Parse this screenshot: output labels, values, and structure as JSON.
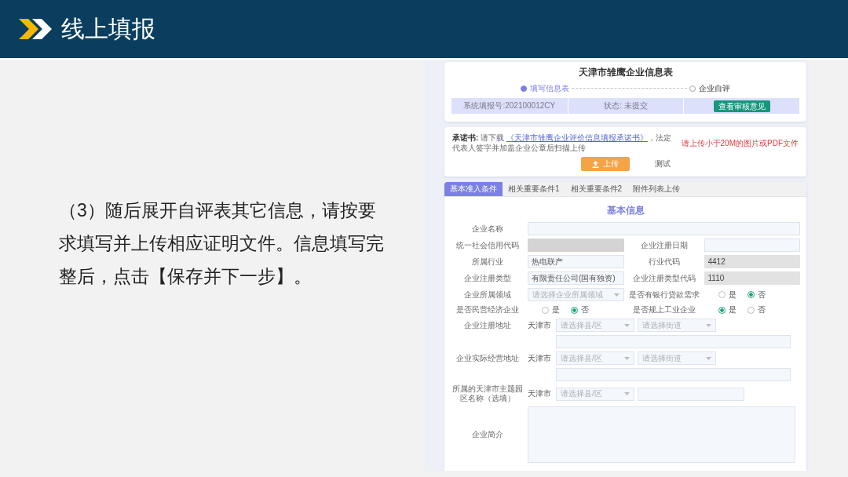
{
  "slide": {
    "title": "线上填报",
    "body": "（3）随后展开自评表其它信息，请按要求填写并上传相应证明文件。信息填写完整后，点击【保存并下一步】。"
  },
  "form": {
    "title": "天津市雏鹰企业信息表",
    "steps": [
      {
        "label": "填写信息表",
        "selected": true
      },
      {
        "label": "企业自评",
        "selected": false
      }
    ],
    "info_bar": {
      "report_number": "系统填报号:202100012CY",
      "status": "状态: 未提交",
      "review_button": "查看审核意见"
    },
    "commitment": {
      "text": "**承诺书:** 请下载",
      "link": "《天津市雏鹰企业评价信息填报承诺书》",
      "text_after_link": "，法定代表人签字并加盖企业公章后扫描上传",
      "hint": "请上传小于20M的图片或PDF文件",
      "upload_button": "上传",
      "file_name": "测试"
    },
    "tabs": [
      {
        "label": "基本准入条件",
        "selected": true
      },
      {
        "label": "相关重要条件1",
        "selected": false
      },
      {
        "label": "相关重要条件2",
        "selected": false
      },
      {
        "label": "附件列表上传",
        "selected": false
      }
    ],
    "section_title": "基本信息",
    "rows": [
      {
        "kind": "single",
        "label": "企业名称",
        "control": {
          "kind": "input",
          "disabled": false,
          "masked": false
        }
      },
      {
        "kind": "pair",
        "cells": [
          {
            "label": "统一社会信用代码",
            "control": {
              "kind": "input",
              "disabled": false,
              "masked": true
            }
          },
          {
            "label": "企业注册日期",
            "control": {
              "kind": "input",
              "disabled": false,
              "masked": false
            }
          }
        ]
      },
      {
        "kind": "pair",
        "cells": [
          {
            "label": "所属行业",
            "control": {
              "kind": "input",
              "value": "热电联产",
              "disabled": false,
              "masked": false
            }
          },
          {
            "label": "行业代码",
            "control": {
              "kind": "input",
              "value": "4412",
              "disabled": true,
              "masked": false
            }
          }
        ]
      },
      {
        "kind": "pair",
        "cells": [
          {
            "label": "企业注册类型",
            "control": {
              "kind": "input",
              "value": "有限责任公司(国有独资)",
              "disabled": false,
              "masked": false
            }
          },
          {
            "label": "企业注册类型代码",
            "control": {
              "kind": "input",
              "value": "1110",
              "disabled": true,
              "masked": false
            }
          }
        ]
      },
      {
        "kind": "pair",
        "cells": [
          {
            "label": "企业所属领域",
            "control": {
              "kind": "select",
              "placeholder": "请选择企业所属领域"
            }
          },
          {
            "label": "是否有银行贷款需求",
            "control": {
              "kind": "radio",
              "options": [
                {
                  "label": "是",
                  "selected": false
                },
                {
                  "label": "否",
                  "selected": true
                }
              ]
            }
          }
        ]
      },
      {
        "kind": "pair",
        "cells": [
          {
            "label": "是否民营经济企业",
            "control": {
              "kind": "radio",
              "options": [
                {
                  "label": "是",
                  "selected": false
                },
                {
                  "label": "否",
                  "selected": true
                }
              ]
            }
          },
          {
            "label": "是否规上工业企业",
            "control": {
              "kind": "radio",
              "options": [
                {
                  "label": "是",
                  "selected": true
                },
                {
                  "label": "否",
                  "selected": false
                }
              ]
            }
          }
        ]
      },
      {
        "kind": "address",
        "label": "企业注册地址",
        "city": "天津市",
        "controls": [
          {
            "kind": "select",
            "placeholder": "请选择县/区"
          },
          {
            "kind": "select",
            "placeholder": "请选择街道"
          }
        ]
      },
      {
        "kind": "detail",
        "control": {
          "kind": "input",
          "disabled": false,
          "masked": false
        }
      },
      {
        "kind": "address",
        "label": "企业实际经营地址",
        "city": "天津市",
        "controls": [
          {
            "kind": "select",
            "placeholder": "请选择县/区"
          },
          {
            "kind": "select",
            "placeholder": "请选择街道"
          }
        ]
      },
      {
        "kind": "detail",
        "control": {
          "kind": "input",
          "disabled": false,
          "masked": false
        }
      },
      {
        "kind": "address",
        "label": "所属的天津市主题园区名称（选填）",
        "city": "天津市",
        "controls": [
          {
            "kind": "select",
            "placeholder": "请选择县/区"
          },
          {
            "kind": "input",
            "disabled": false,
            "masked": false
          }
        ]
      },
      {
        "kind": "textarea",
        "label": "企业简介"
      }
    ]
  }
}
